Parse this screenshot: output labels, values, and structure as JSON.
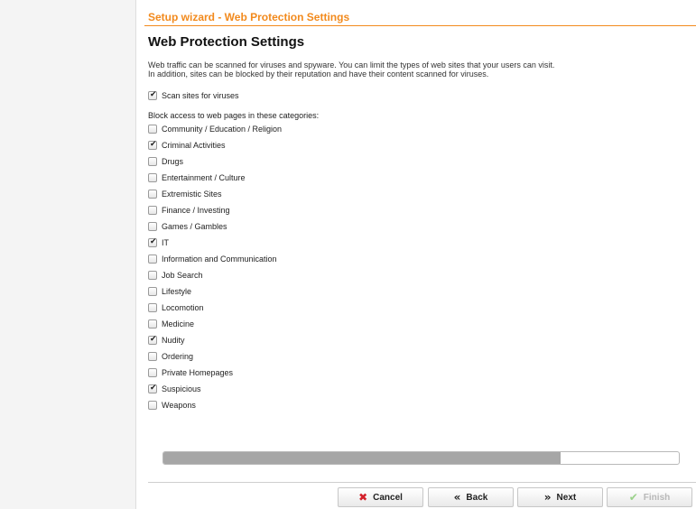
{
  "header": {
    "title": "Setup wizard - Web Protection Settings"
  },
  "page": {
    "title": "Web Protection Settings",
    "intro_line1": "Web traffic can be scanned for viruses and spyware. You can limit the types of web sites that your users can visit.",
    "intro_line2": "In addition, sites can be blocked by their reputation and have their content scanned for viruses."
  },
  "scan": {
    "label": "Scan sites for viruses",
    "checked": true
  },
  "categories": {
    "label": "Block access to web pages in these categories:",
    "items": [
      {
        "label": "Community / Education / Religion",
        "checked": false
      },
      {
        "label": "Criminal Activities",
        "checked": true
      },
      {
        "label": "Drugs",
        "checked": false
      },
      {
        "label": "Entertainment / Culture",
        "checked": false
      },
      {
        "label": "Extremistic Sites",
        "checked": false
      },
      {
        "label": "Finance / Investing",
        "checked": false
      },
      {
        "label": "Games / Gambles",
        "checked": false
      },
      {
        "label": "IT",
        "checked": true
      },
      {
        "label": "Information and Communication",
        "checked": false
      },
      {
        "label": "Job Search",
        "checked": false
      },
      {
        "label": "Lifestyle",
        "checked": false
      },
      {
        "label": "Locomotion",
        "checked": false
      },
      {
        "label": "Medicine",
        "checked": false
      },
      {
        "label": "Nudity",
        "checked": true
      },
      {
        "label": "Ordering",
        "checked": false
      },
      {
        "label": "Private Homepages",
        "checked": false
      },
      {
        "label": "Suspicious",
        "checked": true
      },
      {
        "label": "Weapons",
        "checked": false
      }
    ]
  },
  "progress": {
    "value": 0.77
  },
  "buttons": {
    "cancel": "Cancel",
    "back": "Back",
    "next": "Next",
    "finish": "Finish"
  },
  "icons": {
    "cancel": "close-icon",
    "back": "double-chevron-left-icon",
    "next": "double-chevron-right-icon",
    "finish": "checkmark-icon"
  },
  "colors": {
    "accent": "#f28a1d",
    "cancel_icon": "#d4202a",
    "progress_fill": "#a6a6a6"
  }
}
